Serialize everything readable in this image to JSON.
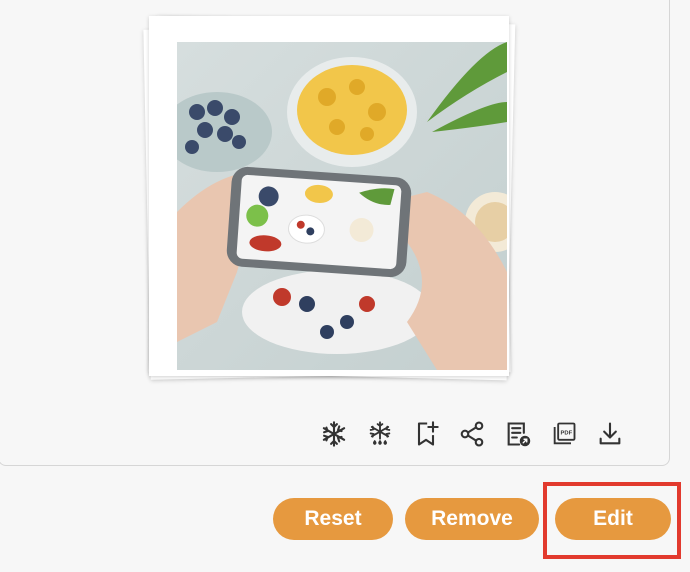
{
  "photo": {
    "alt": "Hands holding a smartphone photographing breakfast on a table"
  },
  "toolbar": {
    "icons": [
      "snowflake-icon",
      "snowflake-drops-icon",
      "bookmark-add-icon",
      "share-icon",
      "document-link-icon",
      "pdf-icon",
      "download-icon"
    ]
  },
  "actions": {
    "reset_label": "Reset",
    "remove_label": "Remove",
    "edit_label": "Edit"
  },
  "colors": {
    "button": "#e6993f",
    "highlight": "#e23a2e",
    "icon": "#333333"
  }
}
